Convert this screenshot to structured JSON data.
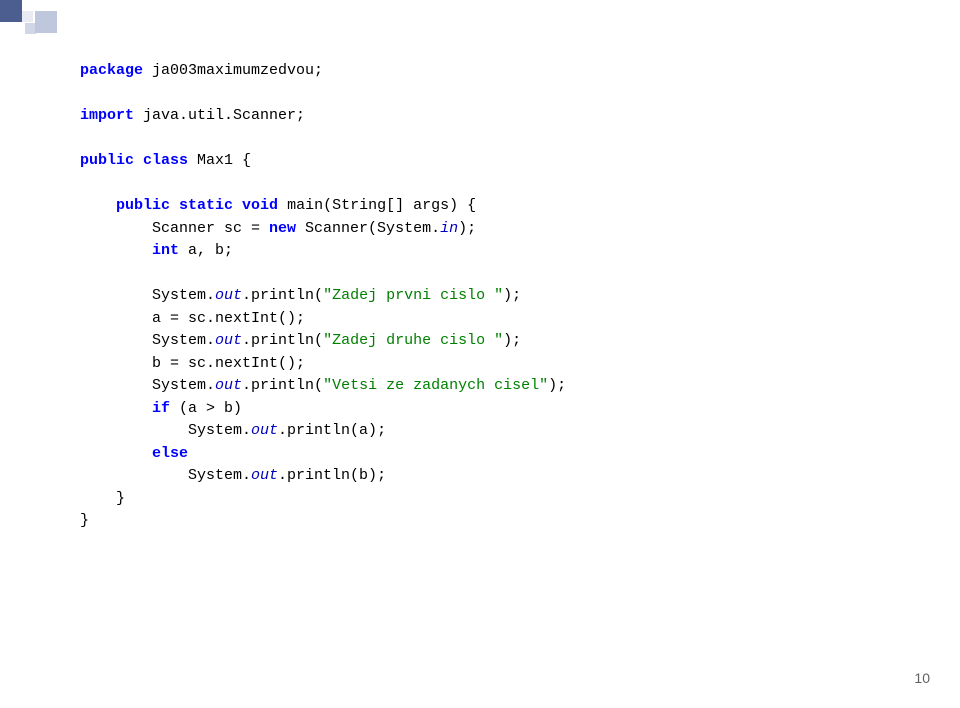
{
  "code": {
    "line1_kw": "package",
    "line1_pkg": " ja003maximumzedvou;",
    "line3_kw": "import",
    "line3_pkg": " java.util.Scanner;",
    "line5_kw1": "public",
    "line5_kw2": " class",
    "line5_rest": " Max1 {",
    "line7_indent": "    ",
    "line7_kw1": "public",
    "line7_kw2": " static",
    "line7_kw3": " void",
    "line7_rest": " main(String[] args) {",
    "line8_indent": "        Scanner sc = ",
    "line8_kw": "new",
    "line8_rest": " Scanner(System.",
    "line8_field": "in",
    "line8_end": ");",
    "line9_indent": "        ",
    "line9_kw": "int",
    "line9_rest": " a, b;",
    "line11_pre": "        System.",
    "line11_field": "out",
    "line11_mid": ".println(",
    "line11_str": "\"Zadej prvni cislo \"",
    "line11_end": ");",
    "line12": "        a = sc.nextInt();",
    "line13_pre": "        System.",
    "line13_field": "out",
    "line13_mid": ".println(",
    "line13_str": "\"Zadej druhe cislo \"",
    "line13_end": ");",
    "line14": "        b = sc.nextInt();",
    "line15_pre": "        System.",
    "line15_field": "out",
    "line15_mid": ".println(",
    "line15_str": "\"Vetsi ze zadanych cisel\"",
    "line15_end": ");",
    "line16_indent": "        ",
    "line16_kw": "if",
    "line16_rest": " (a > b)",
    "line17_pre": "            System.",
    "line17_field": "out",
    "line17_end": ".println(a);",
    "line18_indent": "        ",
    "line18_kw": "else",
    "line19_pre": "            System.",
    "line19_field": "out",
    "line19_end": ".println(b);",
    "line20": "    }",
    "line21": "}"
  },
  "page_number": "10"
}
